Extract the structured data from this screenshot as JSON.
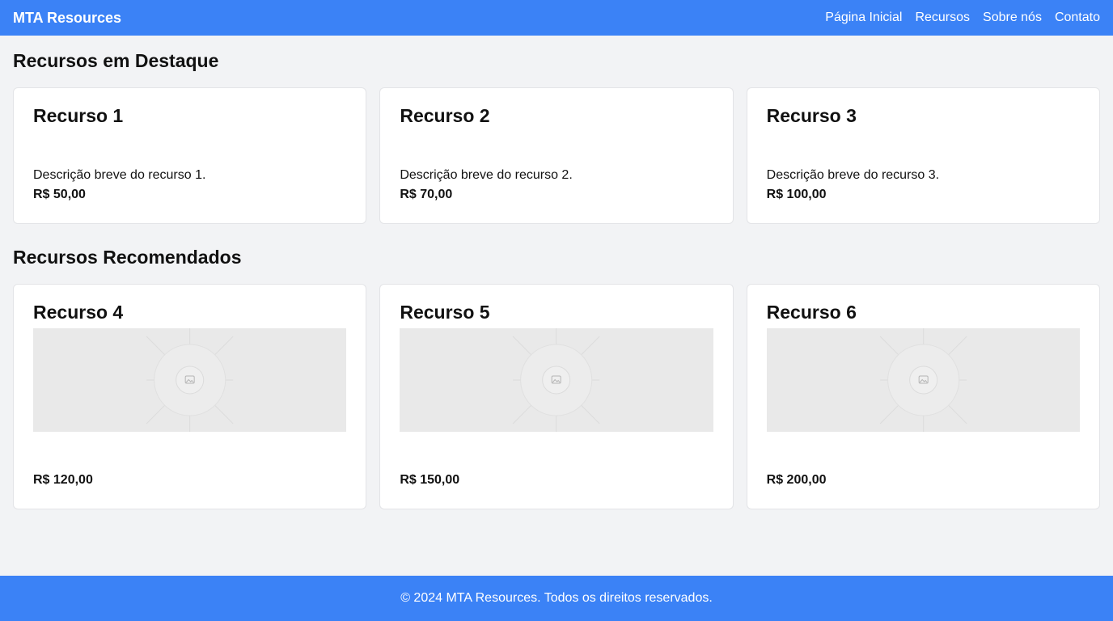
{
  "header": {
    "brand": "MTA Resources",
    "nav": [
      "Página Inicial",
      "Recursos",
      "Sobre nós",
      "Contato"
    ]
  },
  "featured": {
    "title": "Recursos em Destaque",
    "items": [
      {
        "name": "Recurso 1",
        "description": "Descrição breve do recurso 1.",
        "price": "R$ 50,00"
      },
      {
        "name": "Recurso 2",
        "description": "Descrição breve do recurso 2.",
        "price": "R$ 70,00"
      },
      {
        "name": "Recurso 3",
        "description": "Descrição breve do recurso 3.",
        "price": "R$ 100,00"
      }
    ]
  },
  "recommended": {
    "title": "Recursos Recomendados",
    "items": [
      {
        "name": "Recurso 4",
        "image": "image-placeholder-icon",
        "price": "R$ 120,00"
      },
      {
        "name": "Recurso 5",
        "image": "image-placeholder-icon",
        "price": "R$ 150,00"
      },
      {
        "name": "Recurso 6",
        "image": "image-placeholder-icon",
        "price": "R$ 200,00"
      }
    ]
  },
  "footer": {
    "text": "© 2024 MTA Resources. Todos os direitos reservados."
  },
  "colors": {
    "header_bg": "#3b82f6",
    "page_bg": "#f2f3f5",
    "card_bg": "#ffffff"
  }
}
